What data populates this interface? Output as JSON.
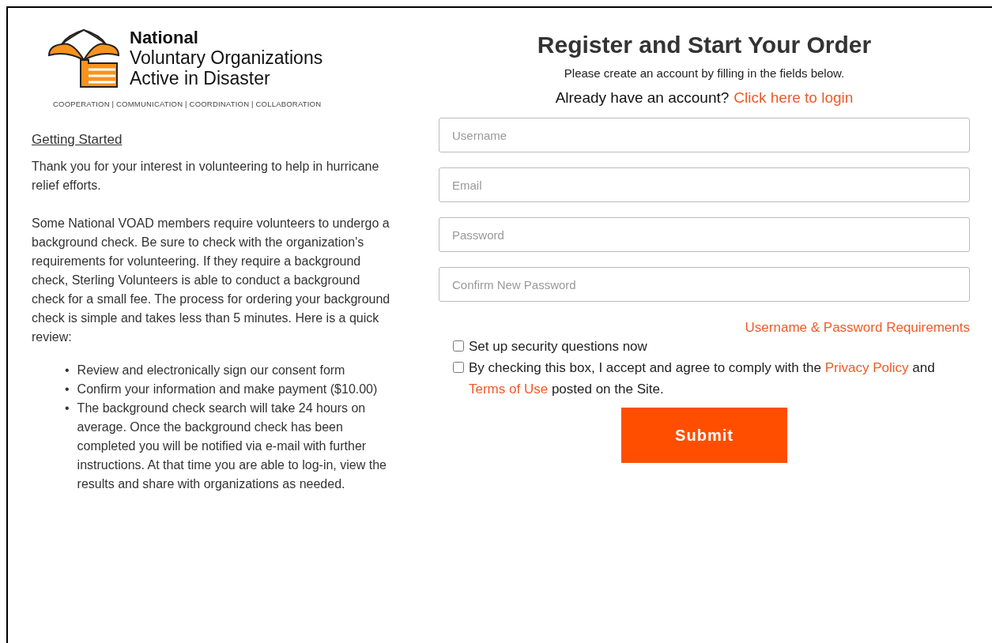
{
  "logo": {
    "title": "National",
    "subtitle_lines": [
      "Voluntary Organizations",
      "Active in Disaster"
    ],
    "tagline": "COOPERATION | COMMUNICATION | COORDINATION | COLLABORATION"
  },
  "intro": {
    "heading": "Getting Started",
    "paragraphs": [
      "Thank you for your interest in volunteering to help in hurricane relief efforts.",
      "Some National VOAD members require volunteers to undergo a background check. Be sure to check with the organization's requirements for volunteering. If they require a background check, Sterling Volunteers is able to conduct a background check for a small fee. The process for ordering your background check is simple and takes less than 5 minutes. Here is a quick review:"
    ],
    "bullet_marker": "•",
    "bullets": [
      "Review and electronically sign our consent form",
      "Confirm your information and make payment ($10.00)",
      "The background check search will take 24 hours on average. Once the background check has been completed you will be notified via e-mail with further instructions. At that time you are able to log-in, view the results and share with organizations as needed."
    ]
  },
  "form": {
    "title": "Register and Start Your Order",
    "subtitle": "Please create an account by filling in the fields below.",
    "login_prompt": {
      "text": "Already have an account?",
      "link": "Click here to login"
    },
    "fields": [
      {
        "placeholder": "Username"
      },
      {
        "placeholder": "Email"
      },
      {
        "placeholder": "Password"
      },
      {
        "placeholder": "Confirm New Password"
      }
    ],
    "requirements_link": "Username & Password Requirements",
    "checkboxes": [
      {
        "kind": "plain",
        "label": "Set up security questions now",
        "checked": false
      },
      {
        "kind": "agreement",
        "label": "By checking this box, I accept and agree to comply with the",
        "link_1": "Privacy Policy",
        "between": "and",
        "link_2": "Terms of Use",
        "after": "posted on the Site.",
        "checked": false
      }
    ],
    "submit": "Submit"
  }
}
